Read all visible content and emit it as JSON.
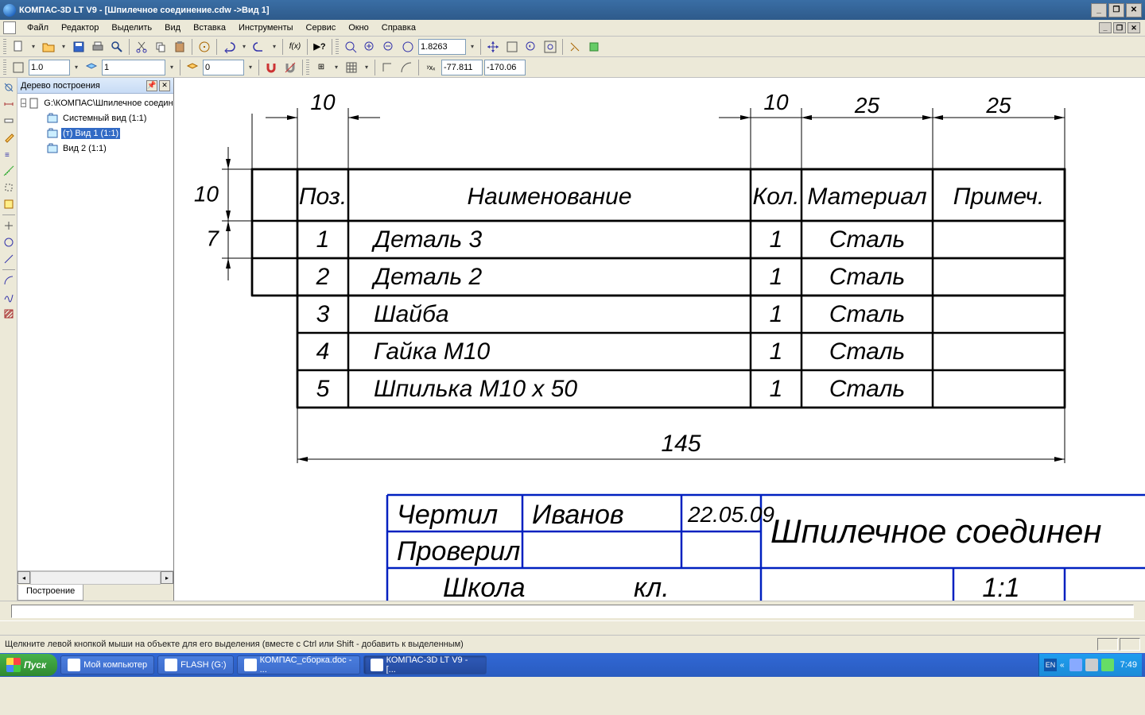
{
  "title": "КОМПАС-3D LT V9 - [Шпилечное соединение.cdw ->Вид 1]",
  "menus": [
    "Файл",
    "Редактор",
    "Выделить",
    "Вид",
    "Вставка",
    "Инструменты",
    "Сервис",
    "Окно",
    "Справка"
  ],
  "toolbar": {
    "zoom": "1.8263",
    "style_combo1": "1.0",
    "style_combo2": "1",
    "style_combo3": "0",
    "coord_x": "-77.811",
    "coord_y": "-170.06"
  },
  "tree": {
    "title": "Дерево построения",
    "root": "G:\\КОМПАС\\Шпилечное соединен",
    "items": [
      "Системный вид (1:1)",
      "(т) Вид 1 (1:1)",
      "Вид 2 (1:1)"
    ],
    "selected_index": 1,
    "tab": "Построение"
  },
  "drawing": {
    "dims_top": [
      "10",
      "10",
      "25",
      "25"
    ],
    "dims_left": [
      "10",
      "7"
    ],
    "total_width": "145",
    "table": {
      "headers": [
        "Поз.",
        "Наименование",
        "Кол.",
        "Материал",
        "Примеч."
      ],
      "rows": [
        {
          "pos": "1",
          "name": "Деталь 3",
          "qty": "1",
          "mat": "Сталь",
          "note": ""
        },
        {
          "pos": "2",
          "name": "Деталь 2",
          "qty": "1",
          "mat": "Сталь",
          "note": ""
        },
        {
          "pos": "3",
          "name": "Шайба",
          "qty": "1",
          "mat": "Сталь",
          "note": ""
        },
        {
          "pos": "4",
          "name": "Гайка М10",
          "qty": "1",
          "mat": "Сталь",
          "note": ""
        },
        {
          "pos": "5",
          "name": "Шпилька М10 х 50",
          "qty": "1",
          "mat": "Сталь",
          "note": ""
        }
      ]
    },
    "stamp": {
      "drew_label": "Чертил",
      "drew_name": "Иванов",
      "date": "22.05.09",
      "checked_label": "Проверил",
      "school": "Школа",
      "class": "кл.",
      "title": "Шпилечное соединен",
      "scale": "1:1"
    }
  },
  "status": "Щелкните левой кнопкой мыши на объекте для его выделения (вместе с Ctrl или Shift - добавить к выделенным)",
  "taskbar": {
    "start": "Пуск",
    "items": [
      "Мой компьютер",
      "FLASH (G:)",
      "КОМПАС_сборка.doc - ...",
      "КОМПАС-3D LT V9 - [..."
    ],
    "lang": "EN",
    "clock": "7:49"
  }
}
